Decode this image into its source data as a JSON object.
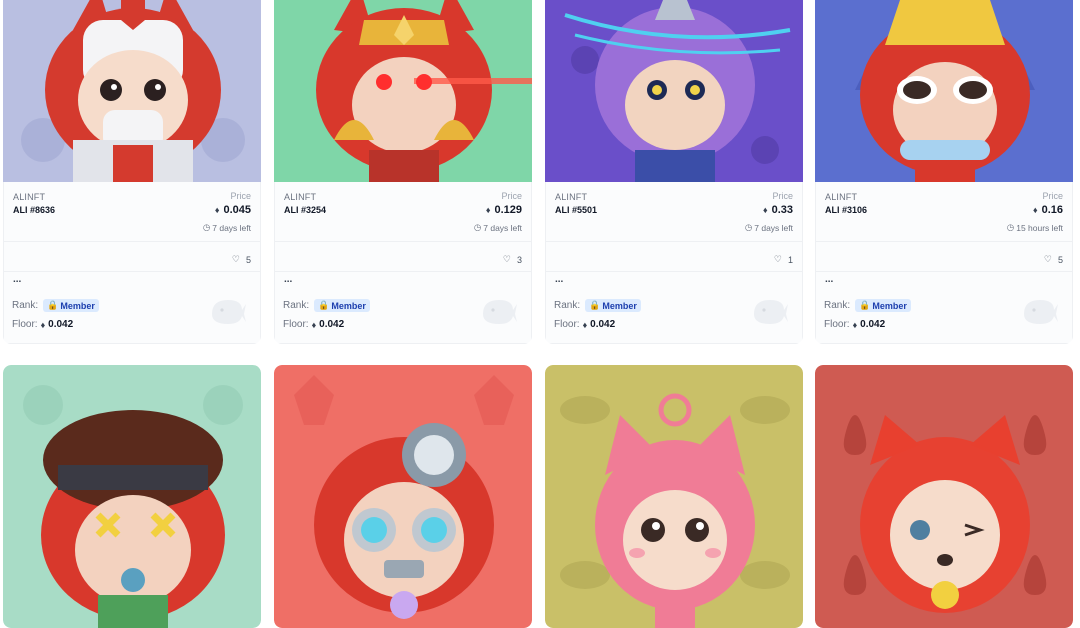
{
  "labels": {
    "price": "Price",
    "rank": "Rank:",
    "member": "Member",
    "floor": "Floor:",
    "dots": "..."
  },
  "icons": {
    "eth": "ethereum-icon",
    "clock": "clock-icon",
    "heart": "heart-icon",
    "lock": "lock-icon",
    "whale": "whale-watermark-icon"
  },
  "cards": [
    {
      "brand": "ALINFT",
      "token": "ALI #8636",
      "price": "0.045",
      "time_left": "7 days left",
      "likes": "5",
      "floor": "0.042"
    },
    {
      "brand": "ALINFT",
      "token": "ALI #3254",
      "price": "0.129",
      "time_left": "7 days left",
      "likes": "3",
      "floor": "0.042"
    },
    {
      "brand": "ALINFT",
      "token": "ALI #5501",
      "price": "0.33",
      "time_left": "7 days left",
      "likes": "1",
      "floor": "0.042"
    },
    {
      "brand": "ALINFT",
      "token": "ALI #3106",
      "price": "0.16",
      "time_left": "15 hours left",
      "likes": "5",
      "floor": "0.042"
    }
  ],
  "colors": {
    "card1_bg": "#b9bfe1",
    "card2_bg": "#7fd6a8",
    "card3_bg": "#6a4fc9",
    "card4_bg": "#5b6fcf",
    "card5_bg": "#a8dcc6",
    "card6_bg": "#ef6f66",
    "card7_bg": "#c9c068",
    "card8_bg": "#cf5b52",
    "badge_bg": "#dbeafe"
  }
}
